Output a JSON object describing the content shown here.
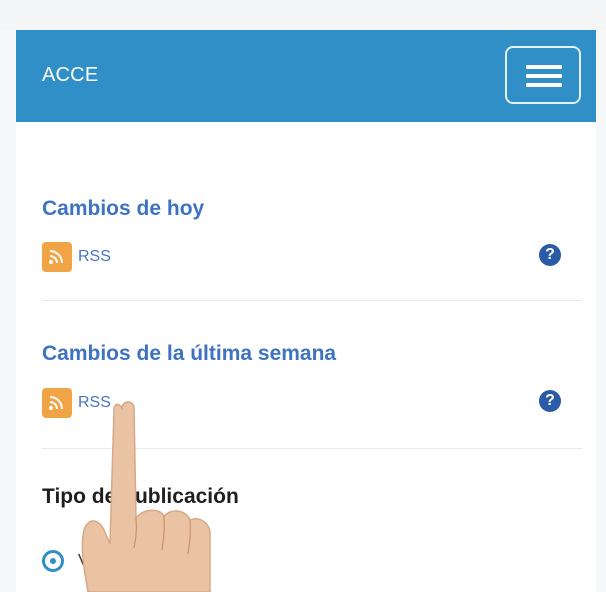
{
  "app": {
    "title": "ACCE"
  },
  "sections": [
    {
      "title": "Cambios de hoy",
      "link_label": "RSS",
      "icon": "rss-icon",
      "help_icon": "question-circle-icon"
    },
    {
      "title": "Cambios de la última semana",
      "link_label": "RSS",
      "icon": "rss-icon",
      "help_icon": "question-circle-icon"
    }
  ],
  "publication": {
    "heading": "Tipo de publicación",
    "options": [
      {
        "label": "Vigentes",
        "selected": true
      }
    ]
  },
  "colors": {
    "navbar": "#2f8fc6",
    "link": "#3f73c2",
    "rss": "#f1a446",
    "help": "#2b5aa6"
  }
}
